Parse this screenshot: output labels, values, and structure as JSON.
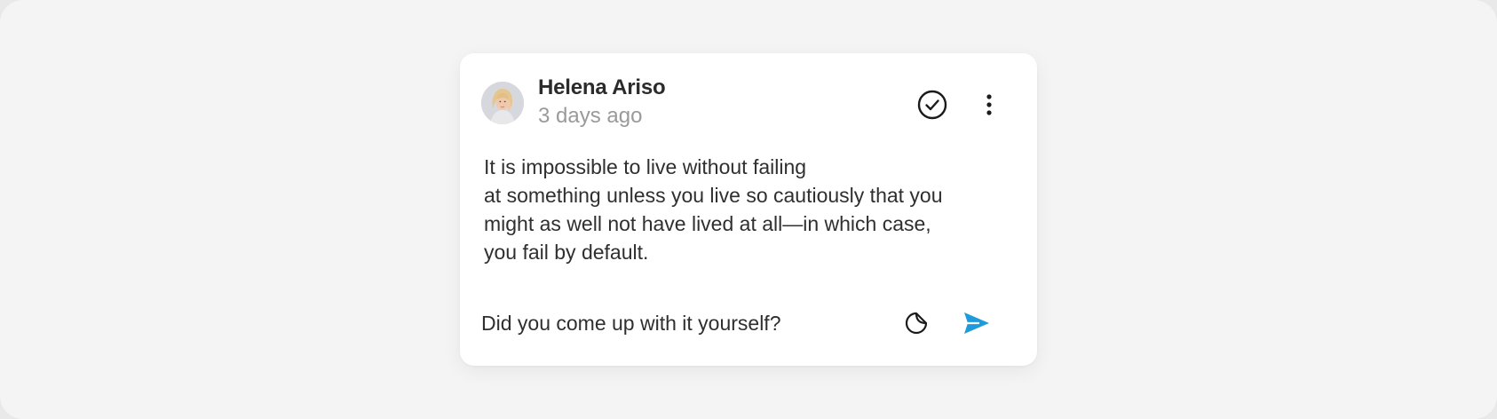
{
  "post": {
    "author": "Helena Ariso",
    "time": "3 days ago",
    "message_lines": [
      "It is impossible to live without failing",
      "at something unless you live so cautiously that you",
      "might as well not have lived at all—in which case,",
      "you fail by default."
    ]
  },
  "actions": {
    "check_icon": "check-circle-icon",
    "more_icon": "more-vertical-icon"
  },
  "reply": {
    "value": "Did you come up with it yourself?",
    "sticker_icon": "sticker-icon",
    "send_icon": "send-icon"
  },
  "colors": {
    "background": "#f4f4f4",
    "card": "#ffffff",
    "text": "#2f2f2f",
    "muted": "#9a9a9a",
    "send_accent": "#1f9bdb"
  }
}
